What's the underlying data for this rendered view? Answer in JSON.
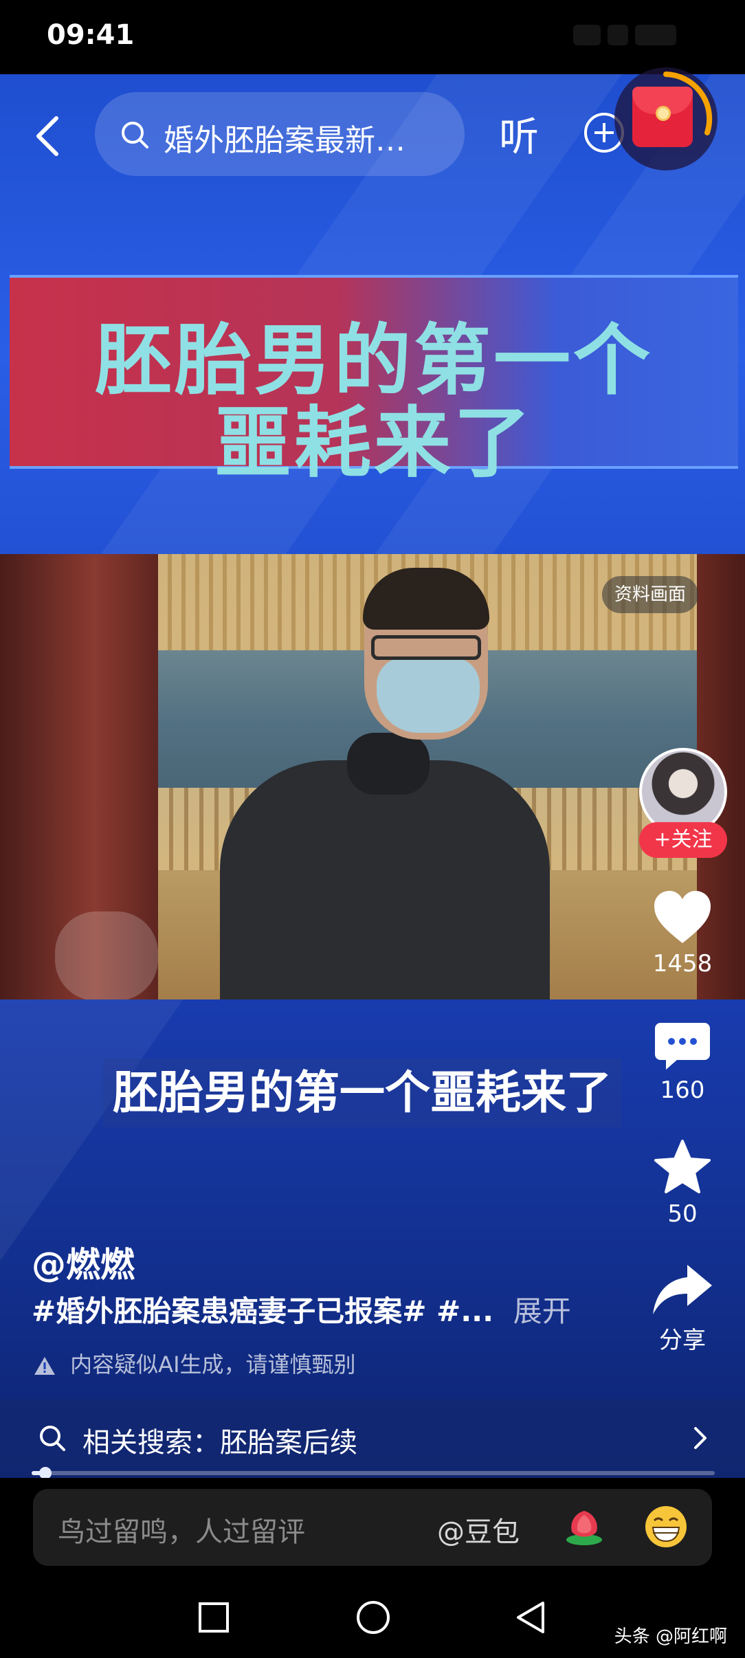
{
  "status_bar": {
    "time": "09:41"
  },
  "top_nav": {
    "search_text": "婚外胚胎案最新…",
    "listen_label": "听"
  },
  "headline": {
    "line1": "胚胎男的第一个",
    "line2": "噩耗来了"
  },
  "video": {
    "source_tag": "资料画面",
    "caption": "胚胎男的第一个噩耗来了",
    "progress": 0.02
  },
  "actions": {
    "follow_label": "+关注",
    "like_count": "1458",
    "comment_count": "160",
    "favorite_count": "50",
    "share_label": "分享"
  },
  "post": {
    "author": "@燃燃",
    "description": "#婚外胚胎案患癌妻子已报案# #...",
    "expand_label": "展开",
    "ai_notice": "内容疑似AI生成，请谨慎甄别"
  },
  "related_search": {
    "text": "相关搜索：胚胎案后续"
  },
  "comment_bar": {
    "placeholder": "鸟过留鸣，人过留评",
    "mention": "@豆包"
  },
  "watermark": "头条 @阿红啊",
  "colors": {
    "accent_red": "#f2364a",
    "headline_text": "#8fe0e4",
    "bg_blue": "#1f4fd0"
  },
  "icons": {
    "back": "chevron-left-icon",
    "search": "search-icon",
    "add": "plus-circle-icon",
    "red_packet": "red-packet-icon",
    "like": "heart-icon",
    "comment": "comment-bubble-icon",
    "favorite": "star-icon",
    "share": "share-arrow-icon",
    "warning": "warning-icon",
    "chevron": "chevron-right-icon",
    "flower": "flower-emoji-icon",
    "smile": "grin-emoji-icon"
  }
}
